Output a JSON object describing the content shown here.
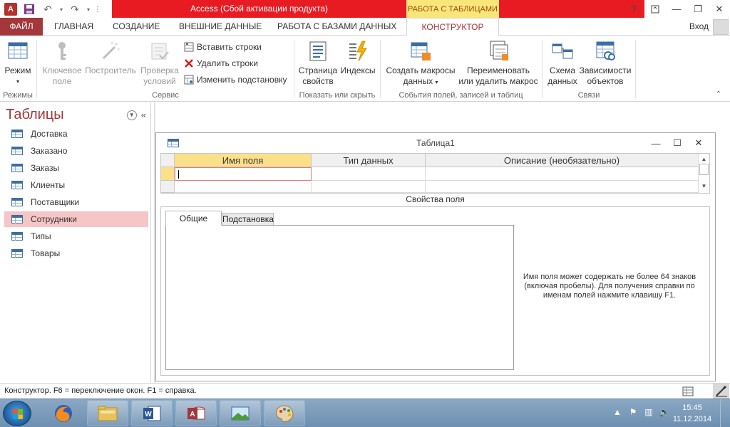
{
  "window": {
    "title": "Access (Сбой активации продукта)",
    "context_tab": "РАБОТА С ТАБЛИЦАМИ",
    "minimize_glyph": "—",
    "maximize_glyph": "❐",
    "close_glyph": "✕",
    "help_glyph": "?"
  },
  "tabs": {
    "file": "ФАЙЛ",
    "items": [
      "ГЛАВНАЯ",
      "СОЗДАНИЕ",
      "ВНЕШНИЕ ДАННЫЕ",
      "РАБОТА С БАЗАМИ ДАННЫХ",
      "КОНСТРУКТОР"
    ],
    "active": "КОНСТРУКТОР",
    "login": "Вход"
  },
  "ribbon": {
    "groups": {
      "modes": "Режимы",
      "service": "Сервис",
      "show_hide": "Показать или скрыть",
      "events": "События полей, записей и таблиц",
      "relations": "Связи"
    },
    "mode_line1": "Режим",
    "key_field_line1": "Ключевое",
    "key_field_line2": "поле",
    "builder": "Построитель",
    "test_rules_line1": "Проверка",
    "test_rules_line2": "условий",
    "insert_rows": "Вставить строки",
    "delete_rows": "Удалить строки",
    "modify_lookup": "Изменить подстановку",
    "property_sheet_line1": "Страница",
    "property_sheet_line2": "свойств",
    "indexes": "Индексы",
    "create_macros_line1": "Создать макросы",
    "create_macros_line2": "данных",
    "rename_macro_line1": "Переименовать",
    "rename_macro_line2": "или удалить макрос",
    "schema_line1": "Схема",
    "schema_line2": "данных",
    "dependencies_line1": "Зависимости",
    "dependencies_line2": "объектов"
  },
  "nav": {
    "title": "Таблицы",
    "items": [
      "Доставка",
      "Заказано",
      "Заказы",
      "Клиенты",
      "Поставщики",
      "Сотрудники",
      "Типы",
      "Товары"
    ],
    "selected": "Сотрудники"
  },
  "document": {
    "title": "Таблица1",
    "columns": [
      "Имя поля",
      "Тип данных",
      "Описание (необязательно)"
    ],
    "properties_label": "Свойства поля",
    "tab_general": "Общие",
    "tab_lookup": "Подстановка",
    "hint": "Имя поля может содержать не более 64 знаков (включая пробелы). Для получения справки по именам полей нажмите клавишу F1."
  },
  "status": {
    "text": "Конструктор.  F6 = переключение окон.  F1 = справка."
  },
  "taskbar": {
    "time": "15:45",
    "date": "11.12.2014"
  },
  "colors": {
    "accent": "#a4373a",
    "title_red": "#e81b23",
    "context_yellow": "#f8e67a",
    "selection_pink": "#f6c5c5",
    "header_yellow": "#fbe08a"
  }
}
